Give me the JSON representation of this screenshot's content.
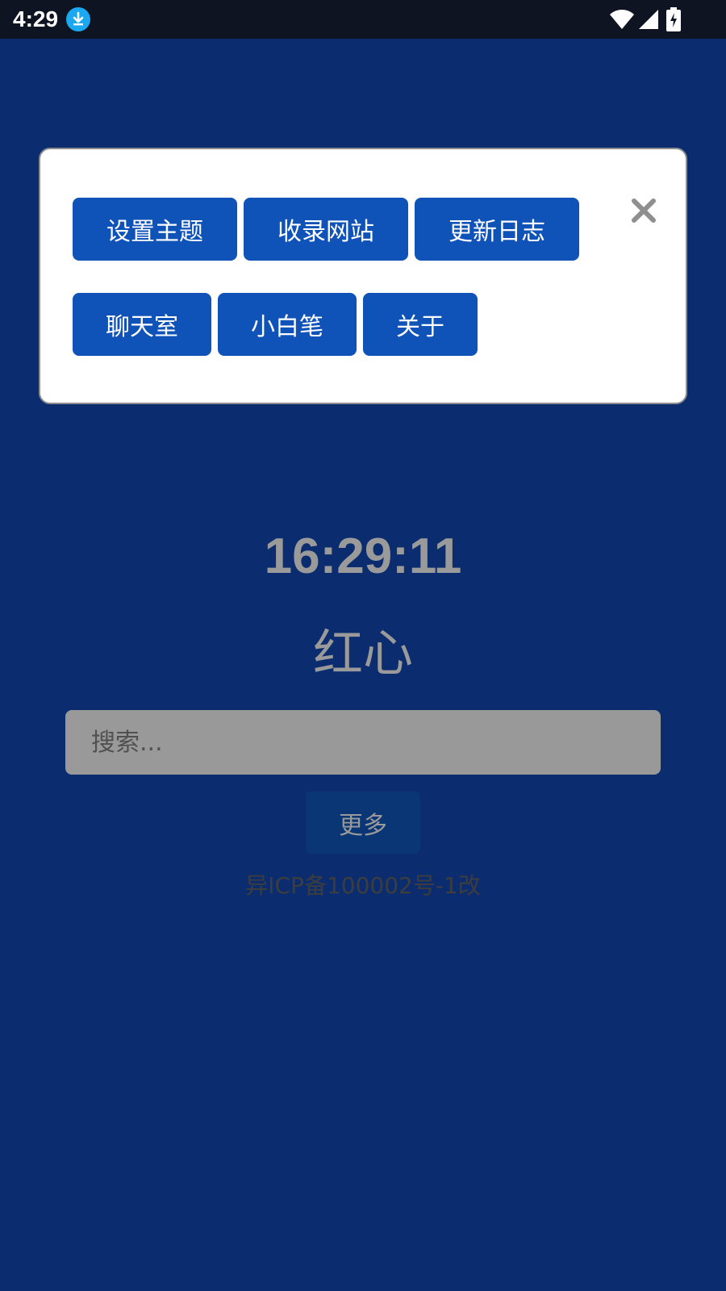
{
  "status_bar": {
    "time": "4:29",
    "icons": [
      "download-icon",
      "wifi-icon",
      "signal-icon",
      "battery-charging-icon"
    ]
  },
  "menu_panel": {
    "buttons": [
      {
        "label": "设置主题"
      },
      {
        "label": "收录网站"
      },
      {
        "label": "更新日志"
      },
      {
        "label": "聊天室"
      },
      {
        "label": "小白笔"
      },
      {
        "label": "关于"
      }
    ],
    "close_icon": "close-icon"
  },
  "main": {
    "clock": "16:29:11",
    "site_name": "红心",
    "search_placeholder": "搜索...",
    "more_label": "更多",
    "icp": "异ICP备100002号-1改"
  },
  "colors": {
    "background": "#0b2d6f",
    "button": "#0f52b8",
    "panel": "#ffffff",
    "muted_text": "#9a9a9a"
  }
}
